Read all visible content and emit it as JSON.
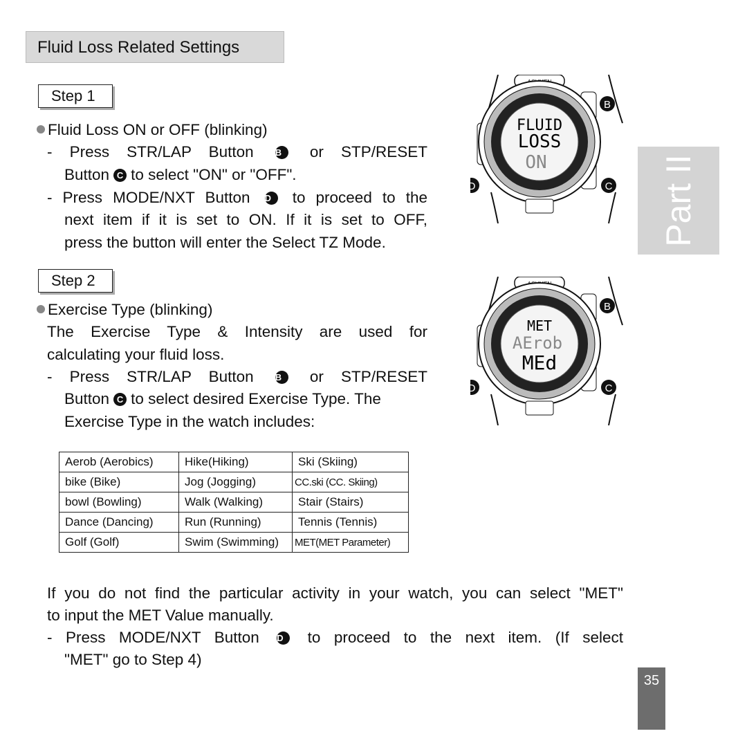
{
  "header": {
    "title": "Fluid Loss Related Settings"
  },
  "step1": {
    "label": "Step 1",
    "bullet": "Fluid Loss ON or OFF (blinking)",
    "l1a": "- Press STR/LAP Button",
    "l1b": "or STP/RESET",
    "l2a": "Button",
    "l2b": "to select \"ON\" or \"OFF\".",
    "l3a": "- Press MODE/NXT Button",
    "l3b": "to proceed to the",
    "l4": "next item if it is set to ON. If it is set to OFF,",
    "l5": "press the button will enter the Select TZ Mode."
  },
  "step2": {
    "label": "Step 2",
    "bullet": "Exercise Type (blinking)",
    "l1": "The Exercise Type & Intensity are used for",
    "l2": "calculating your fluid loss.",
    "l3a": "- Press STR/LAP Button",
    "l3b": "or STP/RESET",
    "l4a": "Button",
    "l4b": "to select desired Exercise Type. The",
    "l5": "Exercise Type in the watch includes:"
  },
  "buttons": {
    "b": "B",
    "c": "C",
    "d": "D"
  },
  "table": [
    [
      "Aerob (Aerobics)",
      "Hike(Hiking)",
      "Ski (Skiing)"
    ],
    [
      "bike (Bike)",
      "Jog (Jogging)",
      "CC.ski (CC. Skiing)"
    ],
    [
      "bowl (Bowling)",
      "Walk (Walking)",
      "Stair (Stairs)"
    ],
    [
      "Dance (Dancing)",
      "Run (Running)",
      "Tennis (Tennis)"
    ],
    [
      "Golf (Golf)",
      "Swim (Swimming)",
      "MET(MET Parameter)"
    ]
  ],
  "bottom": {
    "l1": "If you do not find the particular activity in your watch, you can select \"MET\"",
    "l2": "to input the MET Value manually.",
    "l3a": "- Press MODE/NXT Button",
    "l3b": "to proceed to the next item. (If select",
    "l4": "\"MET\" go to Step 4)"
  },
  "watch1": {
    "brand": "ACUMEN",
    "line1": "FLUID",
    "line2": "LOSS",
    "line3": "ON"
  },
  "watch2": {
    "brand": "ACUMEN",
    "line1": "MET",
    "line2": "AErob",
    "line3": "MEd"
  },
  "side": {
    "part": "Part II",
    "page": "35"
  }
}
